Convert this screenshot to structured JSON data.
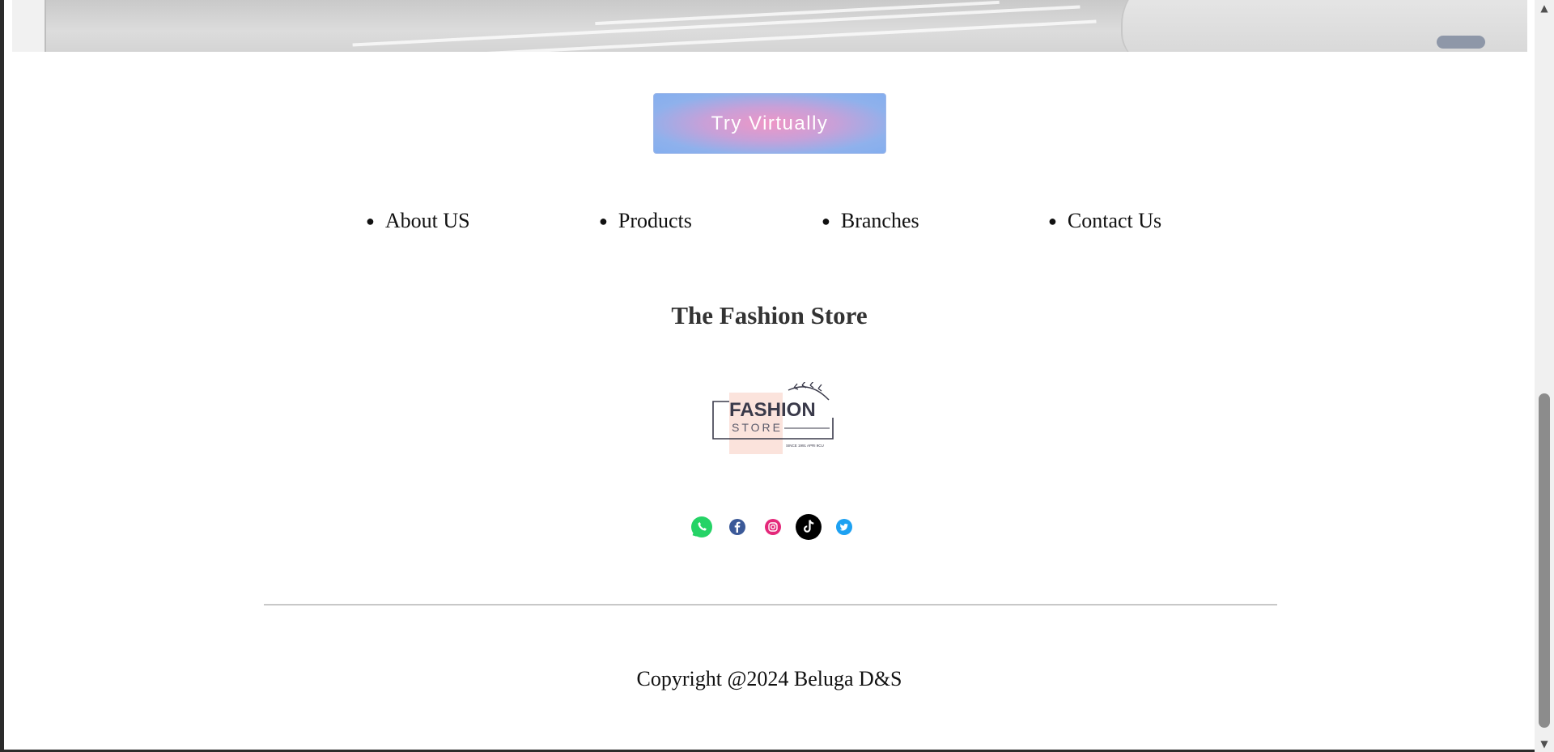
{
  "cta": {
    "label": "Try Virtually"
  },
  "nav": {
    "items": [
      {
        "label": "About US"
      },
      {
        "label": "Products"
      },
      {
        "label": "Branches"
      },
      {
        "label": "Contact Us"
      }
    ]
  },
  "footer": {
    "store_name": "The Fashion Store",
    "logo": {
      "line1": "FASHION",
      "line2": "STORE",
      "tagline": "SINCE 1991 APRI 9CU"
    },
    "social": [
      {
        "name": "whatsapp",
        "color": "#25d366"
      },
      {
        "name": "facebook",
        "color": "#3b5998"
      },
      {
        "name": "instagram",
        "color": "#e4287a"
      },
      {
        "name": "tiktok",
        "color": "#000000"
      },
      {
        "name": "twitter",
        "color": "#1da1f2"
      }
    ],
    "copyright": "Copyright @2024 Beluga D&S"
  },
  "scrollbar": {
    "up": "▲",
    "down": "▼"
  }
}
